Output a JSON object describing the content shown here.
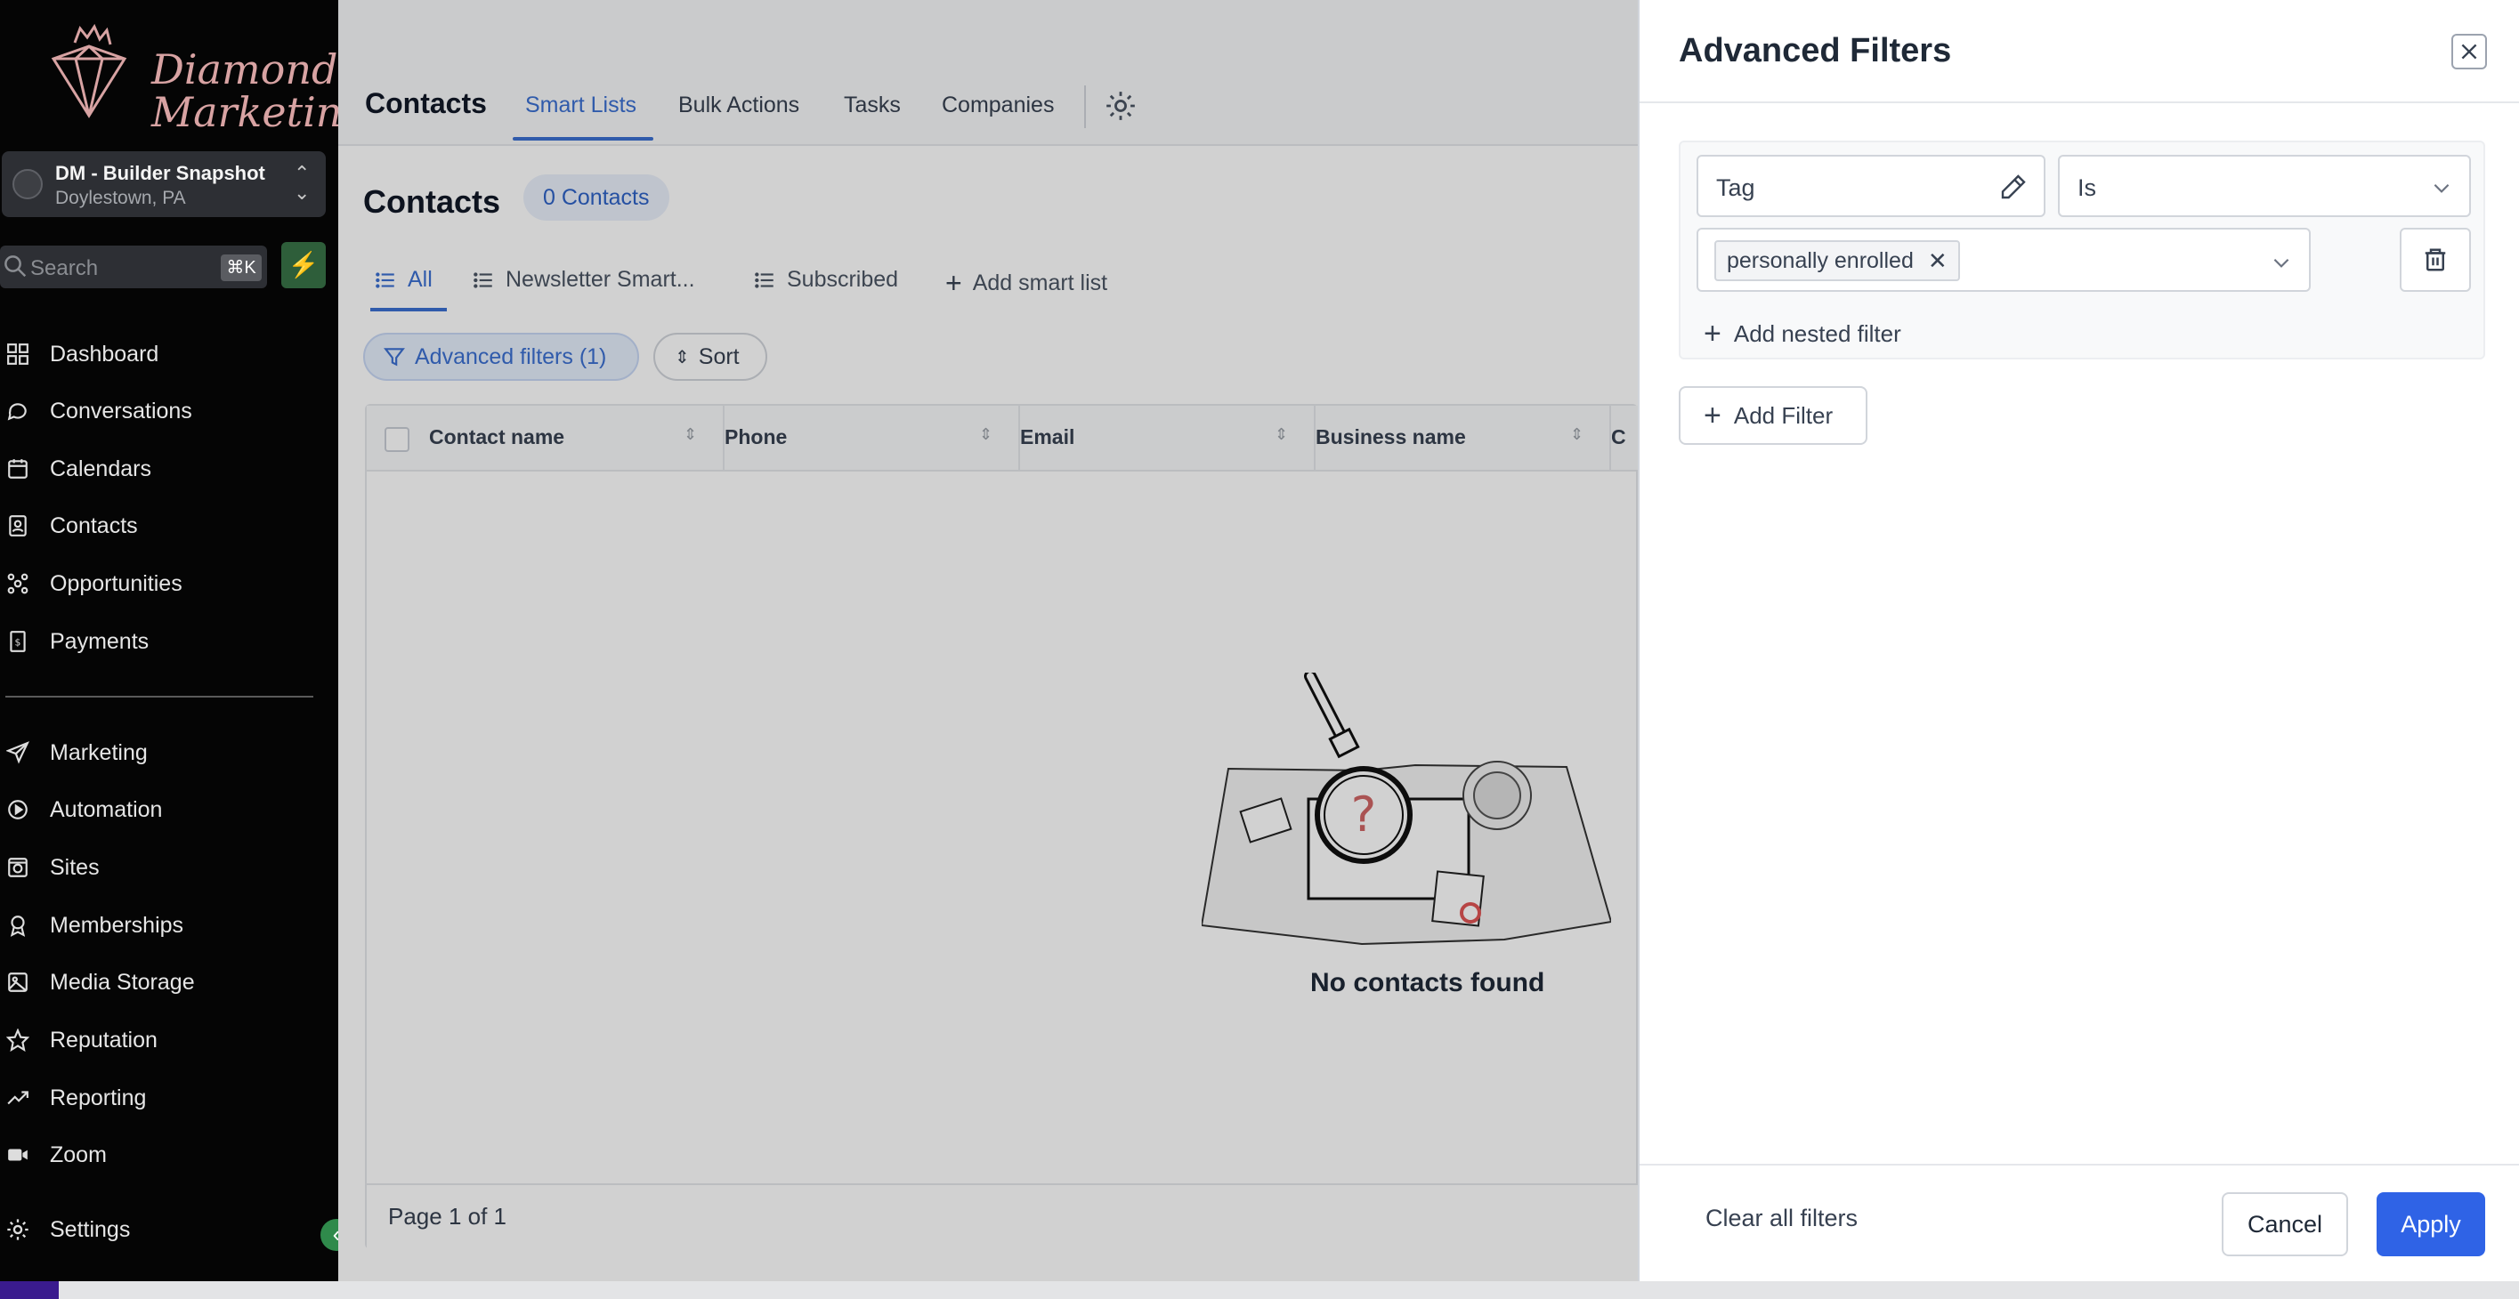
{
  "brand": {
    "logo_text": "Diamond Marketing"
  },
  "account": {
    "name": "DM - Builder Snapshot",
    "location": "Doylestown, PA"
  },
  "search": {
    "placeholder": "Search",
    "shortcut": "⌘K"
  },
  "sidebar": {
    "items": [
      {
        "label": "Dashboard",
        "icon": "dashboard-icon"
      },
      {
        "label": "Conversations",
        "icon": "chat-icon"
      },
      {
        "label": "Calendars",
        "icon": "calendar-icon"
      },
      {
        "label": "Contacts",
        "icon": "contacts-icon"
      },
      {
        "label": "Opportunities",
        "icon": "opportunities-icon"
      },
      {
        "label": "Payments",
        "icon": "payments-icon"
      },
      {
        "label": "Marketing",
        "icon": "send-icon"
      },
      {
        "label": "Automation",
        "icon": "automation-icon"
      },
      {
        "label": "Sites",
        "icon": "sites-icon"
      },
      {
        "label": "Memberships",
        "icon": "memberships-icon"
      },
      {
        "label": "Media Storage",
        "icon": "media-icon"
      },
      {
        "label": "Reputation",
        "icon": "star-icon"
      },
      {
        "label": "Reporting",
        "icon": "trend-icon"
      },
      {
        "label": "Zoom",
        "icon": "video-icon"
      },
      {
        "label": "Settings",
        "icon": "gear-icon"
      }
    ]
  },
  "topbar": {
    "title": "Contacts",
    "tabs": [
      "Smart Lists",
      "Bulk Actions",
      "Tasks",
      "Companies"
    ],
    "active_tab": "Smart Lists"
  },
  "page": {
    "title": "Contacts",
    "count": "0 Contacts"
  },
  "list_tabs": [
    "All",
    "Newsletter Smart...",
    "Subscribed",
    "Add smart list"
  ],
  "toolbar": {
    "advanced_filters": "Advanced filters (1)",
    "sort": "Sort"
  },
  "table": {
    "columns": [
      "Contact name",
      "Phone",
      "Email",
      "Business name",
      "C"
    ],
    "empty_text": "No contacts found",
    "pagination": "Page 1 of 1"
  },
  "panel": {
    "title": "Advanced Filters",
    "filter": {
      "field": "Tag",
      "operator": "Is",
      "value_chip": "personally enrolled"
    },
    "add_nested": "Add nested filter",
    "add_filter": "Add Filter",
    "clear_all": "Clear all filters",
    "cancel": "Cancel",
    "apply": "Apply"
  },
  "colors": {
    "accent": "#3b6fd1",
    "apply": "#2f63e6",
    "sidebar": "#050505",
    "logo": "#d8a3a3"
  }
}
